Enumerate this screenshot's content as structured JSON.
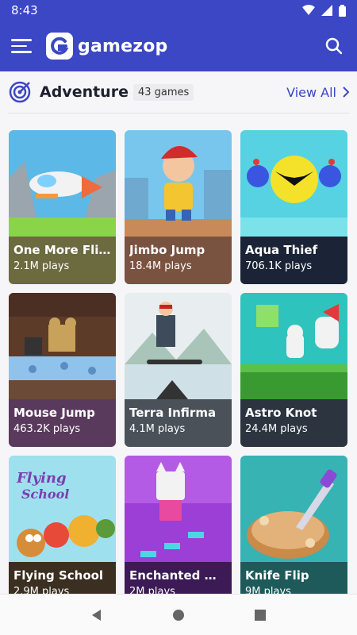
{
  "status_bar": {
    "time": "8:43"
  },
  "app": {
    "name": "gamezop"
  },
  "section": {
    "title": "Adventure",
    "count": "43 games",
    "view_all": "View All"
  },
  "games": [
    {
      "title": "One More Flig…",
      "plays": "2.1M plays",
      "bg": "#6c6a3f"
    },
    {
      "title": "Jimbo Jump",
      "plays": "18.4M plays",
      "bg": "#7a5240"
    },
    {
      "title": "Aqua Thief",
      "plays": "706.1K plays",
      "bg": "#1b2436"
    },
    {
      "title": "Mouse Jump",
      "plays": "463.2K plays",
      "bg": "#5a3a5c"
    },
    {
      "title": "Terra Infirma",
      "plays": "4.1M plays",
      "bg": "#4a5158"
    },
    {
      "title": "Astro Knot",
      "plays": "24.4M plays",
      "bg": "#2c3440"
    },
    {
      "title": "Flying School",
      "plays": "2.9M plays",
      "bg": "#3b2f21"
    },
    {
      "title": "Enchanted W…",
      "plays": "2M plays",
      "bg": "#3b1a55"
    },
    {
      "title": "Knife Flip",
      "plays": "9M plays",
      "bg": "#1f5a5a"
    }
  ],
  "colors": {
    "primary": "#3b47c4",
    "accent_text": "#3b47c4"
  }
}
